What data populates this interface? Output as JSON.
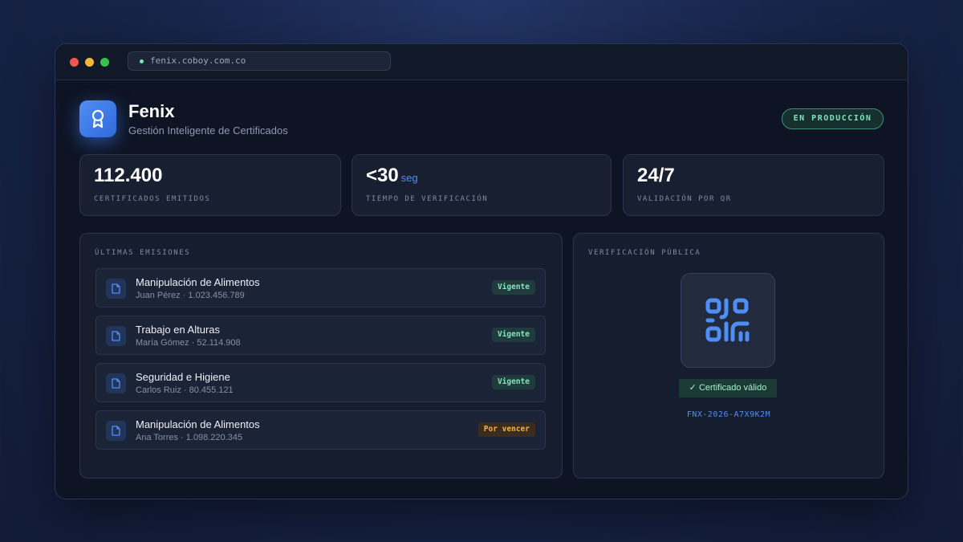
{
  "browser": {
    "url": "fenix.coboy.com.co"
  },
  "app": {
    "name": "Fenix",
    "subtitle": "Gestión Inteligente de Certificados",
    "status_badge": "EN PRODUCCIÓN",
    "logo_icon": "award-ribbon-icon"
  },
  "stats": [
    {
      "value": "112.400",
      "unit": "",
      "label": "CERTIFICADOS EMITIDOS"
    },
    {
      "value": "<30",
      "unit": "seg",
      "label": "TIEMPO DE VERIFICACIÓN"
    },
    {
      "value": "24/7",
      "unit": "",
      "label": "VALIDACIÓN POR QR"
    }
  ],
  "emissions": {
    "title": "ÚLTIMAS EMISIONES",
    "items": [
      {
        "title": "Manipulación de Alimentos",
        "meta": "Juan Pérez · 1.023.456.789",
        "status": "Vigente",
        "status_type": "ok"
      },
      {
        "title": "Trabajo en Alturas",
        "meta": "María Gómez · 52.114.908",
        "status": "Vigente",
        "status_type": "ok"
      },
      {
        "title": "Seguridad e Higiene",
        "meta": "Carlos Ruiz · 80.455.121",
        "status": "Vigente",
        "status_type": "ok"
      },
      {
        "title": "Manipulación de Alimentos",
        "meta": "Ana Torres · 1.098.220.345",
        "status": "Por vencer",
        "status_type": "warn"
      }
    ]
  },
  "verification": {
    "title": "VERIFICACIÓN PÚBLICA",
    "qr_icon": "qr-code-icon",
    "valid_label": "✓ Certificado válido",
    "code": "FNX-2026-A7X9K2M"
  },
  "colors": {
    "accent": "#4f8ef5",
    "success": "#86e3bd",
    "warning": "#f3b447",
    "background": "#0e1424"
  }
}
